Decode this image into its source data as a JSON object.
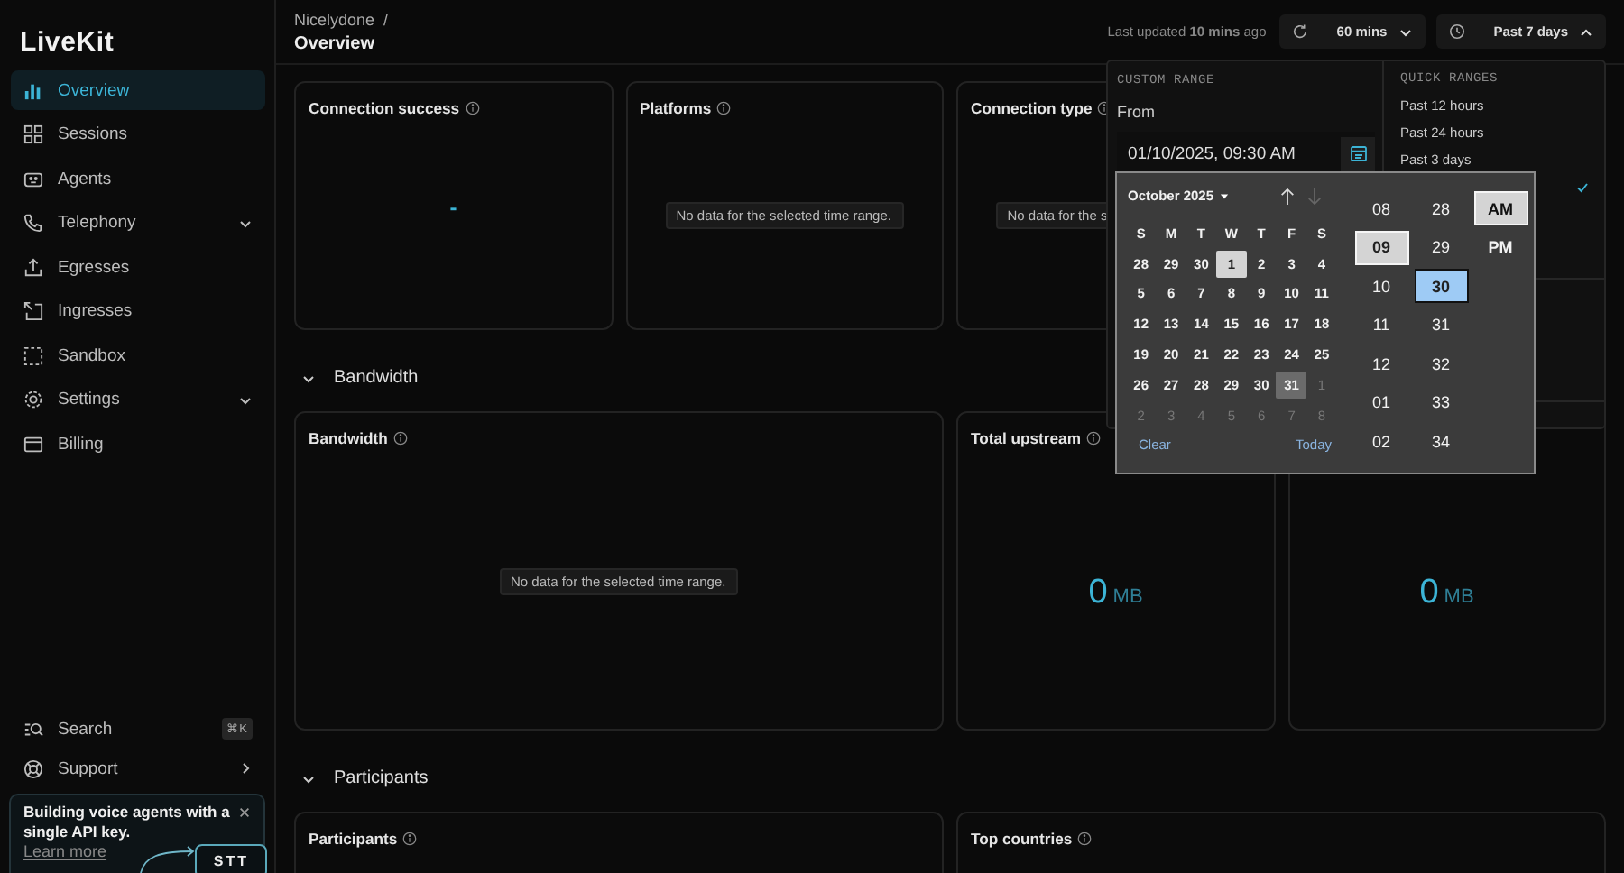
{
  "sidebar": {
    "logo": "LiveKit",
    "nav": [
      {
        "label": "Overview",
        "selected": true,
        "expandable": false
      },
      {
        "label": "Sessions",
        "selected": false,
        "expandable": false
      },
      {
        "label": "Agents",
        "selected": false,
        "expandable": false
      },
      {
        "label": "Telephony",
        "selected": false,
        "expandable": true
      },
      {
        "label": "Egresses",
        "selected": false,
        "expandable": false
      },
      {
        "label": "Ingresses",
        "selected": false,
        "expandable": false
      },
      {
        "label": "Sandbox",
        "selected": false,
        "expandable": false
      },
      {
        "label": "Settings",
        "selected": false,
        "expandable": true
      },
      {
        "label": "Billing",
        "selected": false,
        "expandable": false
      }
    ],
    "search": {
      "label": "Search",
      "shortcut": "⌘K"
    },
    "support": {
      "label": "Support"
    },
    "promo": {
      "text": "Building voice agents with a single API key.",
      "link": "Learn more",
      "chip": "STT"
    }
  },
  "header": {
    "breadcrumb": "Nicelydone",
    "separator": "/",
    "title": "Overview",
    "last_updated": "Last updated **10 mins** ago",
    "refresh": "60 mins",
    "range": {
      "label": "Past 7 days",
      "open": true
    }
  },
  "overview_cards": [
    {
      "title": "Connection success",
      "kind": "dash",
      "value": "-"
    },
    {
      "title": "Platforms",
      "kind": "empty",
      "message": "No data for the selected time range."
    },
    {
      "title": "Connection type",
      "kind": "empty",
      "message": "No data for the s"
    }
  ],
  "sections": [
    {
      "title": "Bandwidth",
      "expanded": true,
      "cards": [
        {
          "title": "Bandwidth",
          "wide": true,
          "kind": "empty",
          "message": "No data for the selected time range."
        },
        {
          "title": "Total upstream",
          "wide": false,
          "kind": "metric",
          "value": "0",
          "unit": "MB"
        },
        {
          "wide": false,
          "kind": "metric",
          "value": "0",
          "unit": "MB"
        }
      ]
    },
    {
      "title": "Participants",
      "expanded": true,
      "cards": [
        {
          "title": "Participants",
          "wide": true,
          "kind": "blank"
        },
        {
          "title": "Top countries",
          "wide": true,
          "kind": "blank"
        }
      ]
    }
  ],
  "range_popover": {
    "custom_heading": "CUSTOM RANGE",
    "from_label": "From",
    "from_value": "01/10/2025, 09:30 AM",
    "quick_heading": "QUICK RANGES",
    "quick_ranges": [
      {
        "label": "Past 12 hours",
        "selected": false
      },
      {
        "label": "Past 24 hours",
        "selected": false
      },
      {
        "label": "Past 3 days",
        "selected": false
      },
      {
        "selected": true
      }
    ]
  },
  "picker": {
    "month": "October 2025",
    "weekdays": [
      "S",
      "M",
      "T",
      "W",
      "T",
      "F",
      "S"
    ],
    "weeks": [
      [
        {
          "t": "28",
          "muted": false,
          "selected": false,
          "today": false
        },
        {
          "t": "29",
          "muted": false,
          "selected": false,
          "today": false
        },
        {
          "t": "30",
          "muted": false,
          "selected": false,
          "today": false
        },
        {
          "t": "1",
          "muted": false,
          "selected": true,
          "today": false
        },
        {
          "t": "2",
          "muted": false,
          "selected": false,
          "today": false
        },
        {
          "t": "3",
          "muted": false,
          "selected": false,
          "today": false
        },
        {
          "t": "4",
          "muted": false,
          "selected": false,
          "today": false
        }
      ],
      [
        {
          "t": "5",
          "muted": false,
          "selected": false,
          "today": false
        },
        {
          "t": "6",
          "muted": false,
          "selected": false,
          "today": false
        },
        {
          "t": "7",
          "muted": false,
          "selected": false,
          "today": false
        },
        {
          "t": "8",
          "muted": false,
          "selected": false,
          "today": false
        },
        {
          "t": "9",
          "muted": false,
          "selected": false,
          "today": false
        },
        {
          "t": "10",
          "muted": false,
          "selected": false,
          "today": false
        },
        {
          "t": "11",
          "muted": false,
          "selected": false,
          "today": false
        }
      ],
      [
        {
          "t": "12",
          "muted": false,
          "selected": false,
          "today": false
        },
        {
          "t": "13",
          "muted": false,
          "selected": false,
          "today": false
        },
        {
          "t": "14",
          "muted": false,
          "selected": false,
          "today": false
        },
        {
          "t": "15",
          "muted": false,
          "selected": false,
          "today": false
        },
        {
          "t": "16",
          "muted": false,
          "selected": false,
          "today": false
        },
        {
          "t": "17",
          "muted": false,
          "selected": false,
          "today": false
        },
        {
          "t": "18",
          "muted": false,
          "selected": false,
          "today": false
        }
      ],
      [
        {
          "t": "19",
          "muted": false,
          "selected": false,
          "today": false
        },
        {
          "t": "20",
          "muted": false,
          "selected": false,
          "today": false
        },
        {
          "t": "21",
          "muted": false,
          "selected": false,
          "today": false
        },
        {
          "t": "22",
          "muted": false,
          "selected": false,
          "today": false
        },
        {
          "t": "23",
          "muted": false,
          "selected": false,
          "today": false
        },
        {
          "t": "24",
          "muted": false,
          "selected": false,
          "today": false
        },
        {
          "t": "25",
          "muted": false,
          "selected": false,
          "today": false
        }
      ],
      [
        {
          "t": "26",
          "muted": false,
          "selected": false,
          "today": false
        },
        {
          "t": "27",
          "muted": false,
          "selected": false,
          "today": false
        },
        {
          "t": "28",
          "muted": false,
          "selected": false,
          "today": false
        },
        {
          "t": "29",
          "muted": false,
          "selected": false,
          "today": false
        },
        {
          "t": "30",
          "muted": false,
          "selected": false,
          "today": false
        },
        {
          "t": "31",
          "muted": false,
          "selected": false,
          "today": true
        },
        {
          "t": "1",
          "muted": true,
          "selected": false,
          "today": false
        }
      ],
      [
        {
          "t": "2",
          "muted": true,
          "selected": false,
          "today": false
        },
        {
          "t": "3",
          "muted": true,
          "selected": false,
          "today": false
        },
        {
          "t": "4",
          "muted": true,
          "selected": false,
          "today": false
        },
        {
          "t": "5",
          "muted": true,
          "selected": false,
          "today": false
        },
        {
          "t": "6",
          "muted": true,
          "selected": false,
          "today": false
        },
        {
          "t": "7",
          "muted": true,
          "selected": false,
          "today": false
        },
        {
          "t": "8",
          "muted": true,
          "selected": false,
          "today": false
        }
      ]
    ],
    "hours": [
      {
        "t": "08",
        "selected": false
      },
      {
        "t": "09",
        "selected": true
      },
      {
        "t": "10",
        "selected": false
      },
      {
        "t": "11",
        "selected": false
      },
      {
        "t": "12",
        "selected": false
      },
      {
        "t": "01",
        "selected": false
      },
      {
        "t": "02",
        "selected": false
      }
    ],
    "minutes": [
      {
        "t": "28",
        "selected": false
      },
      {
        "t": "29",
        "selected": false
      },
      {
        "t": "30",
        "selected": true
      },
      {
        "t": "31",
        "selected": false
      },
      {
        "t": "32",
        "selected": false
      },
      {
        "t": "33",
        "selected": false
      },
      {
        "t": "34",
        "selected": false
      }
    ],
    "periods": [
      {
        "t": "AM",
        "selected": true
      },
      {
        "t": "PM",
        "selected": false
      }
    ],
    "clear": "Clear",
    "today": "Today"
  }
}
